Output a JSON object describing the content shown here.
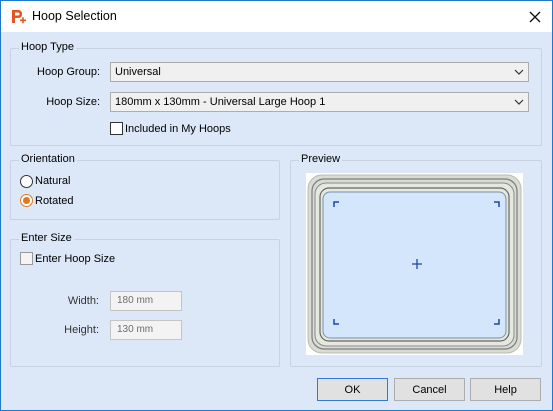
{
  "window": {
    "title": "Hoop Selection",
    "accent_color": "#1e77c9",
    "background_color": "#dce8f7"
  },
  "hoop_type": {
    "title": "Hoop Type",
    "group_label": "Hoop Group:",
    "group_value": "Universal",
    "size_label": "Hoop Size:",
    "size_value": "180mm x 130mm - Universal Large Hoop 1",
    "included_label": "Included in My Hoops",
    "included_checked": false
  },
  "orientation": {
    "title": "Orientation",
    "options": [
      {
        "label": "Natural",
        "checked": false
      },
      {
        "label": "Rotated",
        "checked": true
      }
    ]
  },
  "enter_size": {
    "title": "Enter Size",
    "checkbox_label": "Enter Hoop Size",
    "checked": false,
    "width_label": "Width:",
    "width_value": "180 mm",
    "height_label": "Height:",
    "height_value": "130 mm"
  },
  "preview": {
    "title": "Preview"
  },
  "buttons": {
    "ok": "OK",
    "cancel": "Cancel",
    "help": "Help"
  },
  "icons": {
    "app": "app-icon",
    "close": "close-icon",
    "dropdown": "chevron-down-icon",
    "center": "crosshair-icon"
  }
}
